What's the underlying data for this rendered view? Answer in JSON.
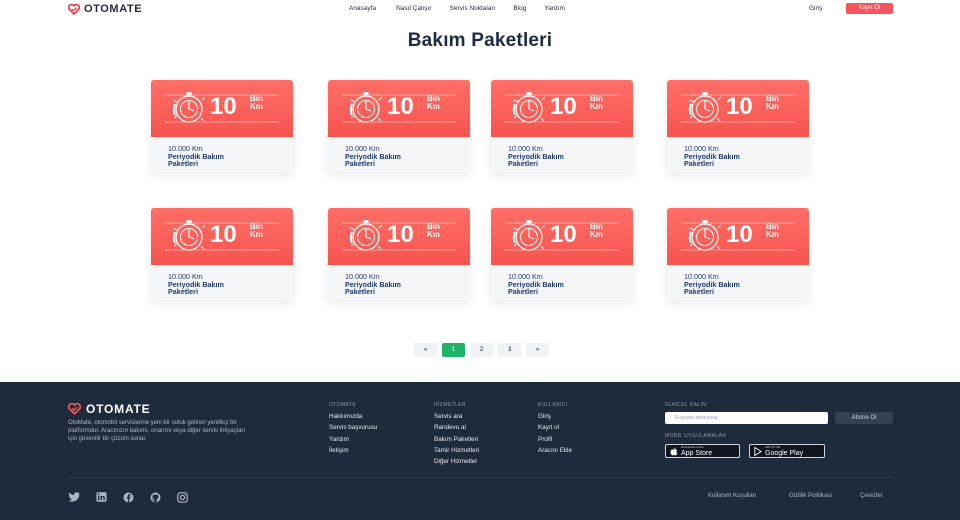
{
  "header": {
    "brand": "OTOMATE",
    "nav": [
      "Anasayfa",
      "Nasıl Çalışır",
      "Servis Noktaları",
      "Blog",
      "Yardım"
    ],
    "login": "Giriş",
    "signup": "Kayıt Ol"
  },
  "page_title": "Bakım Paketleri",
  "cards": [
    {
      "number": "10",
      "unit_top": "Bin",
      "unit_bottom": "Km",
      "km": "10.000 Km",
      "title1": "Periyodik Bakım",
      "title2": "Paketleri"
    },
    {
      "number": "10",
      "unit_top": "Bin",
      "unit_bottom": "Km",
      "km": "10.000 Km",
      "title1": "Periyodik Bakım",
      "title2": "Paketleri"
    },
    {
      "number": "10",
      "unit_top": "Bin",
      "unit_bottom": "Km",
      "km": "10.000 Km",
      "title1": "Periyodik Bakım",
      "title2": "Paketleri"
    },
    {
      "number": "10",
      "unit_top": "Bin",
      "unit_bottom": "Km",
      "km": "10.000 Km",
      "title1": "Periyodik Bakım",
      "title2": "Paketleri"
    },
    {
      "number": "10",
      "unit_top": "Bin",
      "unit_bottom": "Km",
      "km": "10.000 Km",
      "title1": "Periyodik Bakım",
      "title2": "Paketleri"
    },
    {
      "number": "10",
      "unit_top": "Bin",
      "unit_bottom": "Km",
      "km": "10.000 Km",
      "title1": "Periyodik Bakım",
      "title2": "Paketleri"
    },
    {
      "number": "10",
      "unit_top": "Bin",
      "unit_bottom": "Km",
      "km": "10.000 Km",
      "title1": "Periyodik Bakım",
      "title2": "Paketleri"
    },
    {
      "number": "10",
      "unit_top": "Bin",
      "unit_bottom": "Km",
      "km": "10.000 Km",
      "title1": "Periyodik Bakım",
      "title2": "Paketleri"
    }
  ],
  "pagination": {
    "prev": "«",
    "pages": [
      "1",
      "2",
      "3"
    ],
    "active": "1",
    "next": "»"
  },
  "footer": {
    "brand": "OTOMATE",
    "description": "OtoMate, otomobil servislerine yeni bir soluk getiren yenilikçi bir platformdur. Aracınızın bakımı, onarımı veya diğer servis ihtiyaçları için güvenilir bir çözüm sunar.",
    "col1": {
      "title": "OTOMATE",
      "links": [
        "Hakkımızda",
        "Servis başvurusu",
        "Yardım",
        "İletişim"
      ]
    },
    "col2": {
      "title": "HİZMETLER",
      "links": [
        "Servis ara",
        "Randevu al",
        "Bakım Paketleri",
        "Tamir Hizmetleri",
        "Diğer Hizmetler"
      ]
    },
    "col3": {
      "title": "KULLANICI",
      "links": [
        "Giriş",
        "Kayıt ol",
        "Profil",
        "Aracını Ekle"
      ]
    },
    "subscribe_title": "GÜNCEL KALIN",
    "email_placeholder": "E-posta adresiniz",
    "subscribe_button": "Abone Ol",
    "mobile_title": "MOBİL UYGULAMALAR",
    "appstore_small": "Download on the",
    "appstore_big": "App Store",
    "googleplay_small": "GET IT ON",
    "googleplay_big": "Google Play",
    "legal": [
      "Kullanım Koşulları",
      "Gizlilik Politikası",
      "Çerezler"
    ]
  },
  "colors": {
    "accent": "#f4545a",
    "active_page": "#1fb36a",
    "footer_bg": "#1e2b3d"
  }
}
